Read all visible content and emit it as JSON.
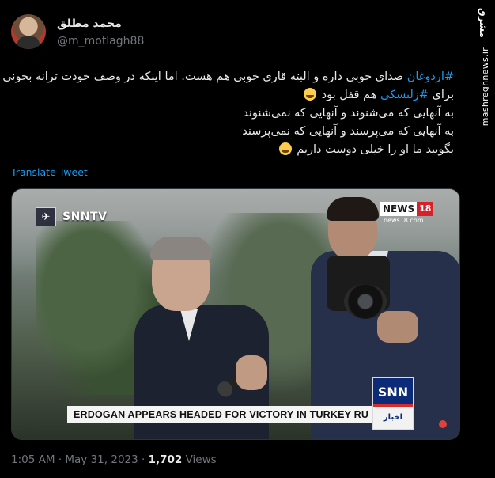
{
  "author": {
    "display_name": "محمد مطلق",
    "handle": "@m_motlagh88"
  },
  "tweet": {
    "lines": [
      {
        "hashtag": "#اردوغان",
        "text": " صدای خوبی داره و البته قاری خوبی هم هست. اما اینکه در وصف خودت ترانه بخونی"
      },
      {
        "prefix": "برای ",
        "hashtag": "#زلنسکی",
        "text": " هم قفل بود",
        "emoji": "sweat-smile-emoji"
      },
      {
        "text": "به آنهایی که می‌شنوند و آنهایی که نمی‌شنوند"
      },
      {
        "text": "به آنهایی که می‌پرسند و آنهایی که نمی‌پرسند"
      },
      {
        "text": "بگویید ما او را خیلی دوست داریم",
        "emoji": "smile-emoji"
      }
    ]
  },
  "translate_label": "Translate Tweet",
  "media": {
    "left_logo_text": "SNNTV",
    "news18": {
      "word": "NEWS",
      "number": "18",
      "url": "news18.com"
    },
    "snn_badge": {
      "top": "SNN",
      "bottom": "اخبار"
    },
    "ticker": "ERDOGAN APPEARS HEADED FOR VICTORY IN TURKEY RU"
  },
  "footer": {
    "time": "1:05 AM",
    "date": "May 31, 2023",
    "views_count": "1,702",
    "views_label": "Views"
  },
  "watermark": {
    "logo": "مشرق",
    "url": "mashreghnews.ir"
  },
  "colors": {
    "background": "#000000",
    "text": "#e7e9ea",
    "muted": "#71767b",
    "link": "#1d9bf0"
  }
}
